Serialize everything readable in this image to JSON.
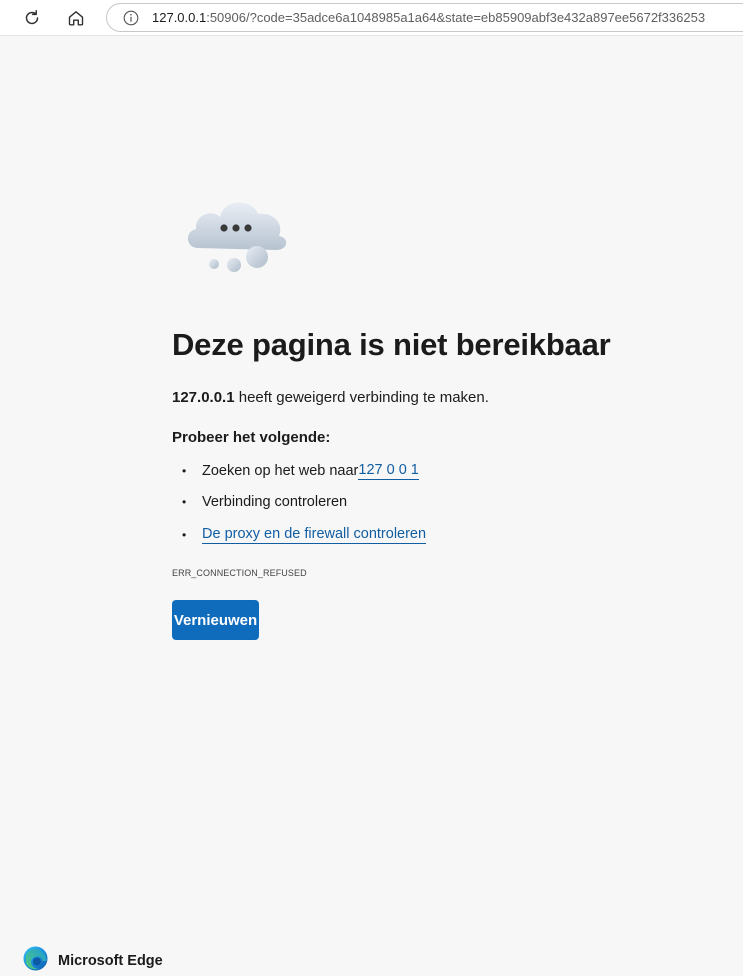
{
  "browser": {
    "url_host": "127.0.0.1",
    "url_rest": ":50906/?code=35adce6a1048985a1a64&state=eb85909abf3e432a897ee5672f336253",
    "icons": {
      "refresh": "refresh-icon",
      "home": "home-icon",
      "site_info": "info-icon"
    }
  },
  "error_page": {
    "illustration": "cloud-ellipsis-icon",
    "title": "Deze pagina is niet bereikbaar",
    "host": "127.0.0.1",
    "message": " heeft geweigerd verbinding te maken.",
    "try_heading": "Probeer het volgende:",
    "suggestions": [
      {
        "prefix": "Zoeken op het web naar ",
        "link": "127 0 0 1"
      },
      {
        "prefix": "Verbinding controleren",
        "link": ""
      },
      {
        "prefix": "",
        "link": "De proxy en de firewall controleren"
      }
    ],
    "error_code": "ERR_CONNECTION_REFUSED",
    "reload_label": "Vernieuwen"
  },
  "footer": {
    "brand": "Microsoft Edge",
    "logo": "edge-logo-icon"
  },
  "colors": {
    "background": "#f7f7f7",
    "accent": "#0f6cbd",
    "link": "#115ea3",
    "text": "#1b1b1b"
  }
}
